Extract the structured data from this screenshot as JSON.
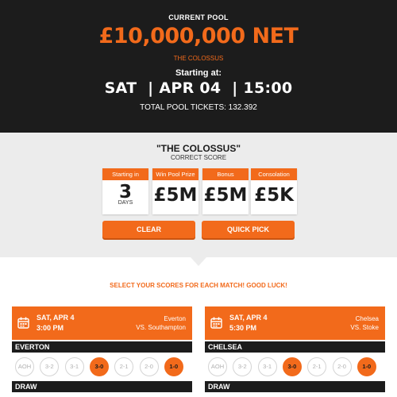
{
  "header": {
    "pool_label": "CURRENT POOL",
    "pool_amount": "£10,000,000 NET",
    "pool_name": "THE COLOSSUS",
    "start_label": "Starting at:",
    "start_datetime": "SAT  | APR 04  | 15:00",
    "tickets": "TOTAL POOL TICKETS: 132.392"
  },
  "game": {
    "title": "\"THE COLOSSUS\"",
    "subtitle": "CORRECT SCORE",
    "cards": [
      {
        "head": "Starting in",
        "value": "3",
        "unit": "DAYS"
      },
      {
        "head": "Win Pool Prize",
        "value": "£5M"
      },
      {
        "head": "Bonus",
        "value": "£5M"
      },
      {
        "head": "Consolation",
        "value": "£5K"
      }
    ],
    "clear_label": "CLEAR",
    "quick_pick_label": "QUICK PICK"
  },
  "prompt": "SELECT YOUR SCORES FOR EACH MATCH! GOOD LUCK!",
  "colors": {
    "accent": "#f26a1b",
    "dark": "#1c1c1c",
    "panel": "#ececec"
  },
  "icons": {
    "calendar": "calendar-icon"
  },
  "matches": [
    {
      "date": "SAT, APR 4",
      "time": "3:00 PM",
      "home": "Everton",
      "away": "VS. Southampton",
      "team_bar": "EVERTON",
      "scores": [
        "AOH",
        "3-2",
        "3-1",
        "3-0",
        "2-1",
        "2-0",
        "1-0"
      ],
      "selected": [
        "3-0",
        "1-0"
      ],
      "draw_label": "DRAW"
    },
    {
      "date": "SAT, APR 4",
      "time": "5:30 PM",
      "home": "Chelsea",
      "away": "VS. Stoke",
      "team_bar": "CHELSEA",
      "scores": [
        "AOH",
        "3-2",
        "3-1",
        "3-0",
        "2-1",
        "2-0",
        "1-0"
      ],
      "selected": [
        "3-0",
        "1-0"
      ],
      "draw_label": "DRAW"
    }
  ]
}
